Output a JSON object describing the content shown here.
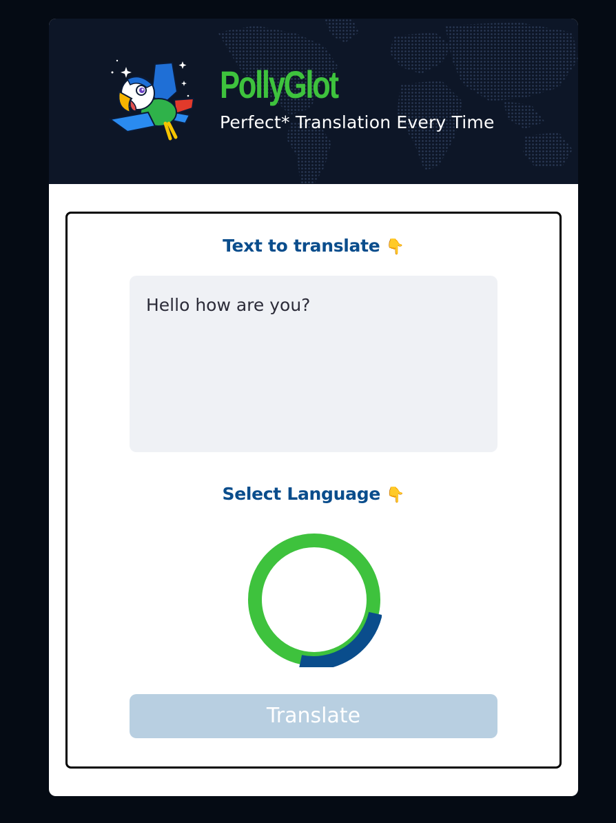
{
  "header": {
    "title": "PollyGlot",
    "subtitle": "Perfect* Translation Every Time",
    "logo_icon": "parrot-icon",
    "background": "world-map"
  },
  "form": {
    "text_label": "Text to translate",
    "text_value": "Hello how are you?",
    "language_label": "Select Language",
    "pointer_icon": "👇",
    "loading_indicator": "spinner",
    "submit_label": "Translate"
  },
  "colors": {
    "page_bg": "#050b14",
    "header_bg": "#0d1627",
    "brand_green": "#3ec23d",
    "label_blue": "#0a4d8c",
    "textarea_bg": "#eff1f5",
    "button_disabled_bg": "#b8cfe1",
    "spinner_green": "#3ec23d",
    "spinner_blue": "#0a4d8c"
  }
}
